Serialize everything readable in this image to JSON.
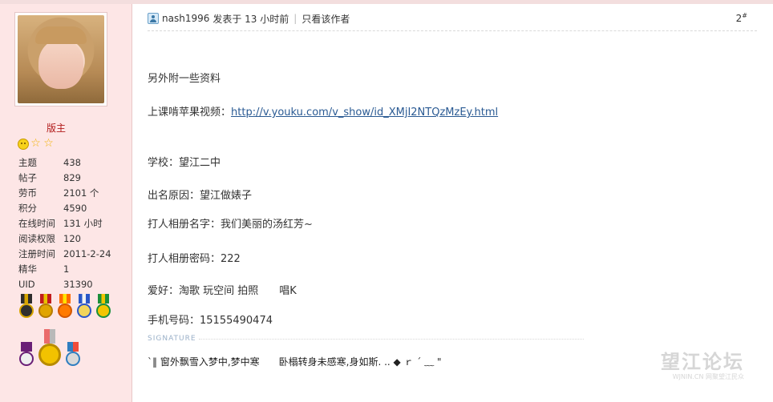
{
  "user": {
    "rank": "版主",
    "stats": [
      {
        "label": "主题",
        "value": "438"
      },
      {
        "label": "帖子",
        "value": "829"
      },
      {
        "label": "劳币",
        "value": "2101 个"
      },
      {
        "label": "积分",
        "value": "4590"
      },
      {
        "label": "在线时间",
        "value": "131 小时"
      },
      {
        "label": "阅读权限",
        "value": "120"
      },
      {
        "label": "注册时间",
        "value": "2011-2-24"
      },
      {
        "label": "精华",
        "value": "1"
      },
      {
        "label": "UID",
        "value": "31390"
      }
    ]
  },
  "post": {
    "author": "nash1996",
    "posted_at": "发表于 13 小时前",
    "only_author": "只看该作者",
    "floor": "2",
    "floor_mark": "#",
    "lines": [
      "另外附一些资料",
      "上课啃苹果视频：",
      "http://v.youku.com/v_show/id_XMjI2NTQzMzEy.html",
      "学校：望江二中",
      "出名原因：望江做婊子",
      "打人相册名字：我们美丽的汤红芳~",
      "打人相册密码：222",
      "爱好：淘歌 玩空间 拍照　　唱K",
      "手机号码：15155490474"
    ],
    "signature_label": "SIGNATURE",
    "signature": "`‖ 窗外飘雪入梦中,梦中寒　　卧榻转身未感寒,身如斯. .. ◆ ｒ ˊ ﹏ \""
  },
  "watermark": {
    "title": "望江论坛",
    "url": "WJNIN.CN 网聚望江民众"
  },
  "colors": {
    "sidebar_bg": "#fde6e6",
    "rank": "#b21b1b",
    "link": "#2a5a93"
  }
}
